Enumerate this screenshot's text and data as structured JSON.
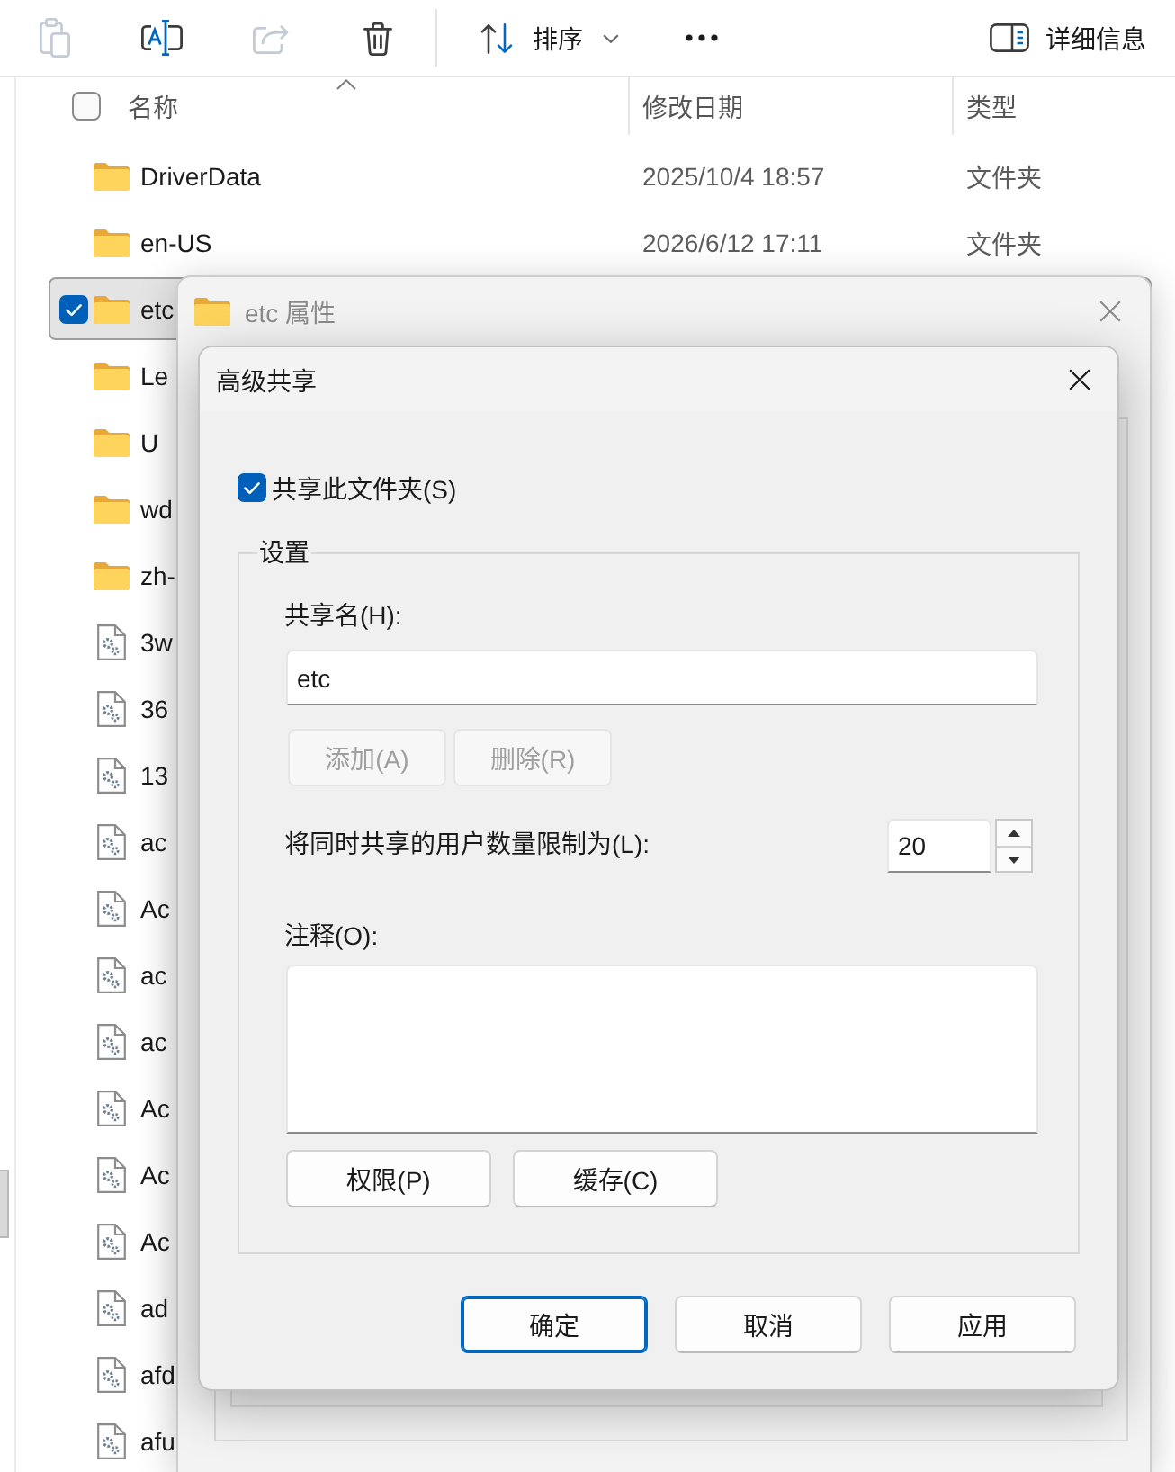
{
  "toolbar": {
    "buttons": [
      {
        "disabled": true
      },
      {
        "disabled": false
      },
      {
        "disabled": true
      },
      {
        "disabled": false
      }
    ],
    "sort_button": {
      "label": "排序"
    },
    "details_button": {
      "label": "详细信息"
    }
  },
  "file_list": {
    "select_all_checked": false,
    "columns": [
      {
        "label": "名称",
        "sorted": true
      },
      {
        "label": "修改日期",
        "sorted": false
      },
      {
        "label": "类型",
        "sorted": false
      }
    ],
    "rows": [
      {
        "kind": "folder",
        "name": "DriverData",
        "modified": "2025/10/4 18:57",
        "type": "文件夹",
        "selected": false
      },
      {
        "kind": "folder",
        "name": "en-US",
        "modified": "2026/6/12 17:11",
        "type": "文件夹",
        "selected": false
      },
      {
        "kind": "folder",
        "name": "etc",
        "selected": true
      },
      {
        "kind": "folder",
        "name": "Le",
        "selected": false
      },
      {
        "kind": "folder",
        "name": "U",
        "selected": false
      },
      {
        "kind": "folder",
        "name": "wd",
        "selected": false
      },
      {
        "kind": "folder",
        "name": "zh-",
        "selected": false
      },
      {
        "kind": "file",
        "name": "3w",
        "selected": false
      },
      {
        "kind": "file",
        "name": "36",
        "selected": false
      },
      {
        "kind": "file",
        "name": "13",
        "selected": false
      },
      {
        "kind": "file",
        "name": "ac",
        "selected": false
      },
      {
        "kind": "file",
        "name": "Ac",
        "selected": false
      },
      {
        "kind": "file",
        "name": "ac",
        "selected": false
      },
      {
        "kind": "file",
        "name": "ac",
        "selected": false
      },
      {
        "kind": "file",
        "name": "Ac",
        "selected": false
      },
      {
        "kind": "file",
        "name": "Ac",
        "selected": false
      },
      {
        "kind": "file",
        "name": "Ac",
        "selected": false
      },
      {
        "kind": "file",
        "name": "ad",
        "selected": false
      },
      {
        "kind": "file",
        "name": "afd",
        "selected": false
      },
      {
        "kind": "file",
        "name": "afu",
        "selected": false
      }
    ]
  },
  "properties_dialog": {
    "title": "etc 属性"
  },
  "sharing_dialog": {
    "title": "高级共享",
    "share_checkbox": {
      "label": "共享此文件夹(S)",
      "checked": true
    },
    "settings": {
      "label": "设置",
      "share_name": {
        "label": "共享名(H):",
        "value": "etc"
      },
      "name_buttons": [
        {
          "label": "添加(A)",
          "disabled": true
        },
        {
          "label": "删除(R)",
          "disabled": true
        }
      ],
      "user_limit": {
        "label": "将同时共享的用户数量限制为(L):",
        "value": "20"
      },
      "comment": {
        "label": "注释(O):"
      },
      "buttons": [
        {
          "label": "权限(P)"
        },
        {
          "label": "缓存(C)"
        }
      ]
    },
    "buttons": [
      {
        "label": "确定",
        "default": true
      },
      {
        "label": "取消",
        "default": false
      },
      {
        "label": "应用",
        "default": false
      }
    ]
  }
}
